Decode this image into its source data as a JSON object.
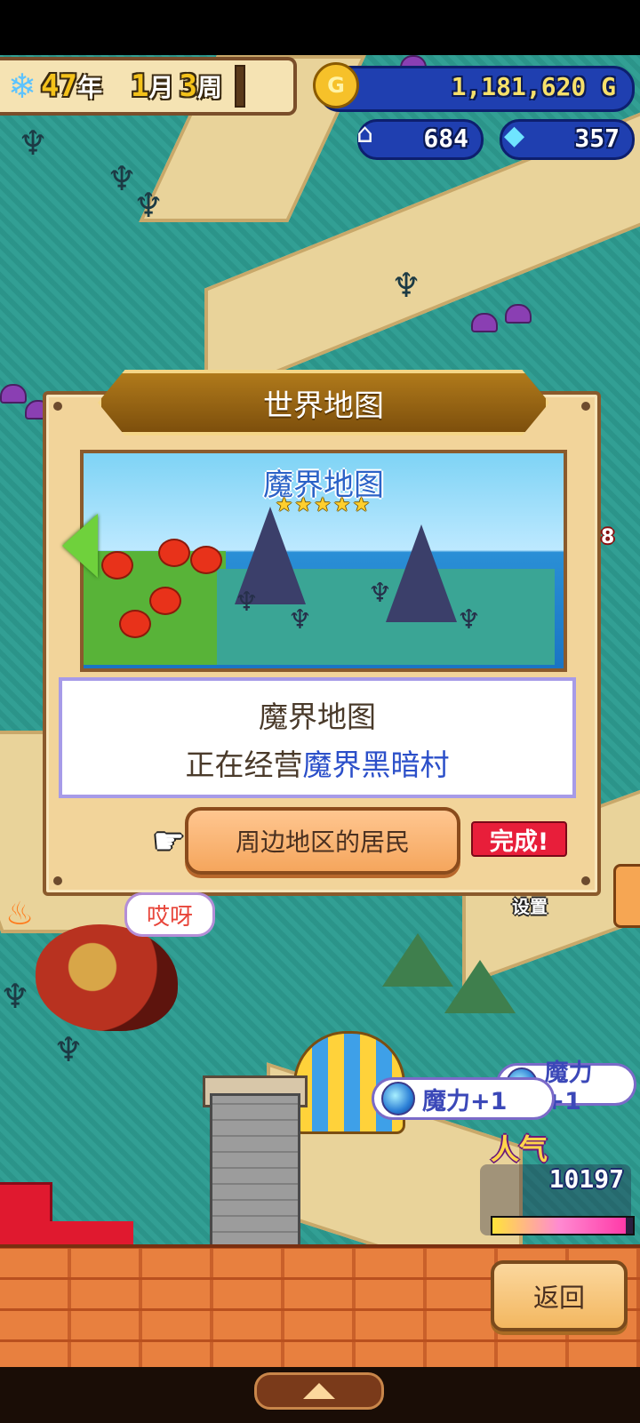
{
  "hud": {
    "year": "47",
    "year_unit": "年",
    "month": "1",
    "month_unit": "月",
    "week": "3",
    "week_unit": "周",
    "gold": "1,181,620 G",
    "population": "684",
    "crystals": "357",
    "season_icon": "snowflake-icon"
  },
  "dialog": {
    "title": "世界地图",
    "map_name": "魔界地图",
    "map_stars": "★★★★★",
    "info_line1": "魔界地图",
    "info_line2_prefix": "正在经营",
    "info_line2_highlight": "魔界黑暗村",
    "residents_button": "周边地区的居民",
    "complete_badge": "完成!"
  },
  "world": {
    "speech_bubble": "哎呀",
    "magic_bubbles": [
      {
        "label": "魔力+1"
      },
      {
        "label": "魔力+1"
      }
    ],
    "popularity_label": "人气",
    "popularity_value": "10197",
    "popularity_level": 0.95,
    "side_label": "设置",
    "side_number": "8"
  },
  "footer": {
    "back_button": "返回"
  },
  "colors": {
    "accent_blue": "#2b4fc9",
    "badge_red": "#e81e3a",
    "button_orange": "#f5a65d",
    "teal_ground": "#2e9d92"
  }
}
